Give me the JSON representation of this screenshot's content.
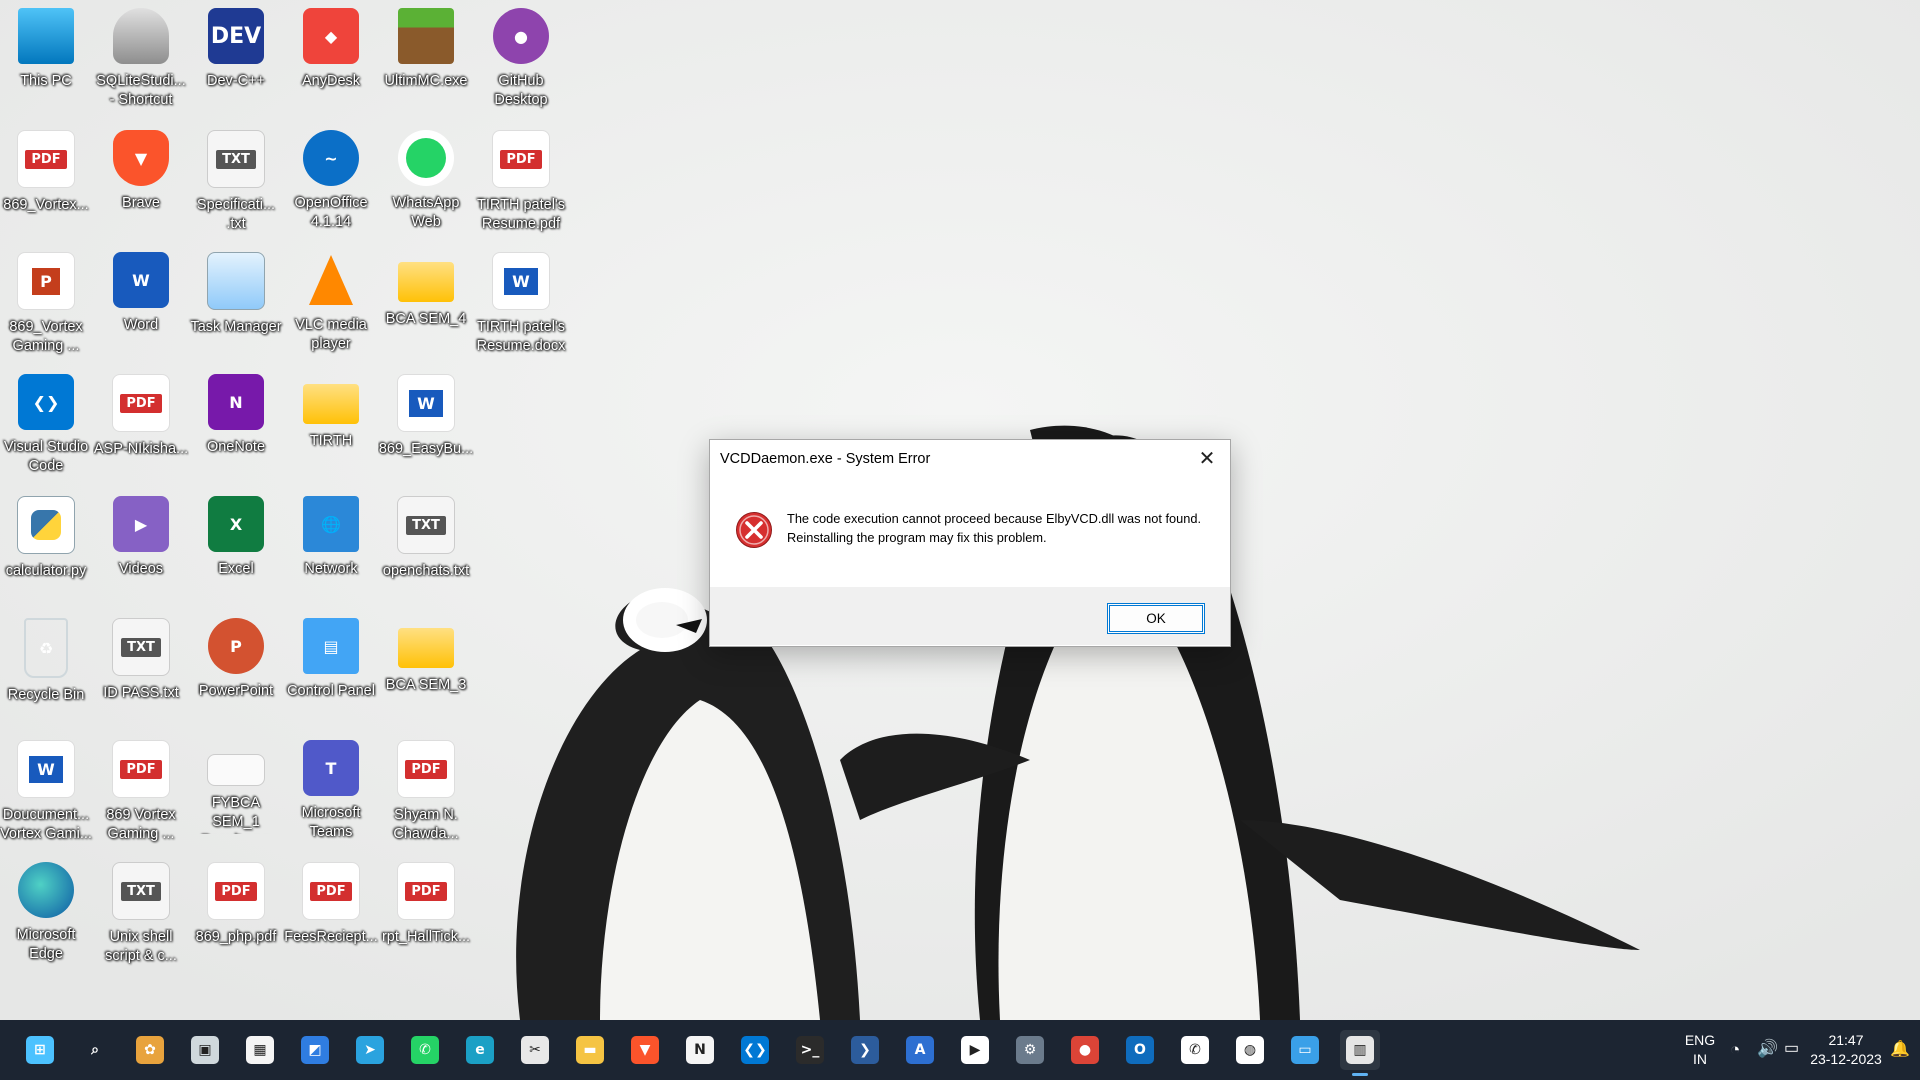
{
  "desktop": {
    "icons": [
      {
        "label": "This PC",
        "icon": "monitor-icon",
        "kind": "g-pc",
        "glyph": ""
      },
      {
        "label": "SQLiteStudi... - Shortcut",
        "icon": "database-icon",
        "kind": "g-db",
        "glyph": ""
      },
      {
        "label": "Dev-C++",
        "icon": "dev-cpp-icon",
        "kind": "g-dev",
        "glyph": "DEV"
      },
      {
        "label": "AnyDesk",
        "icon": "anydesk-icon",
        "kind": "g-any",
        "glyph": "◆"
      },
      {
        "label": "UltimMC.exe",
        "icon": "minecraft-icon",
        "kind": "g-mc",
        "glyph": ""
      },
      {
        "label": "GitHub Desktop",
        "icon": "github-icon",
        "kind": "g-gh",
        "glyph": "●"
      },
      {
        "label": "869_Vortex...",
        "icon": "pdf-file-icon",
        "kind": "g-pdf",
        "glyph": "PDF"
      },
      {
        "label": "Brave",
        "icon": "brave-icon",
        "kind": "g-brave",
        "glyph": "▼"
      },
      {
        "label": "Specificati... .txt",
        "icon": "txt-file-icon",
        "kind": "g-txt",
        "glyph": "TXT"
      },
      {
        "label": "OpenOffice 4.1.14",
        "icon": "openoffice-icon",
        "kind": "g-oo",
        "glyph": "~"
      },
      {
        "label": "WhatsApp Web",
        "icon": "whatsapp-icon",
        "kind": "g-wa",
        "glyph": ""
      },
      {
        "label": "TIRTH patel's Resume.pdf",
        "icon": "pdf-file-icon",
        "kind": "g-pdf",
        "glyph": "PDF"
      },
      {
        "label": "869_Vortex Gaming ...",
        "icon": "powerpoint-file-icon",
        "kind": "g-ppt",
        "glyph": "P"
      },
      {
        "label": "Word",
        "icon": "word-icon",
        "kind": "g-word",
        "glyph": "W"
      },
      {
        "label": "Task Manager",
        "icon": "task-manager-icon",
        "kind": "g-tm",
        "glyph": ""
      },
      {
        "label": "VLC media player",
        "icon": "vlc-icon",
        "kind": "g-vlc",
        "glyph": ""
      },
      {
        "label": "BCA SEM_4",
        "icon": "folder-icon",
        "kind": "g-folder",
        "glyph": ""
      },
      {
        "label": "TIRTH patel's Resume.docx",
        "icon": "word-file-icon",
        "kind": "g-word-doc",
        "glyph": "W"
      },
      {
        "label": "Visual Studio Code",
        "icon": "vscode-icon",
        "kind": "g-vs",
        "glyph": "❮❯"
      },
      {
        "label": "ASP-NIkisha...",
        "icon": "pdf-file-icon",
        "kind": "g-pdf",
        "glyph": "PDF"
      },
      {
        "label": "OneNote",
        "icon": "onenote-icon",
        "kind": "g-one",
        "glyph": "N"
      },
      {
        "label": "TIRTH",
        "icon": "user-folder-icon",
        "kind": "g-folder",
        "glyph": ""
      },
      {
        "label": "869_EasyBu...",
        "icon": "word-file-icon",
        "kind": "g-word-doc",
        "glyph": "W"
      },
      {
        "label": "calculator.py",
        "icon": "python-file-icon",
        "kind": "g-py",
        "glyph": ""
      },
      {
        "label": "Videos",
        "icon": "videos-icon",
        "kind": "g-vid",
        "glyph": "▶"
      },
      {
        "label": "Excel",
        "icon": "excel-icon",
        "kind": "g-xl",
        "glyph": "X"
      },
      {
        "label": "Network",
        "icon": "network-icon",
        "kind": "g-net",
        "glyph": "🌐"
      },
      {
        "label": "openchats.txt",
        "icon": "txt-file-icon",
        "kind": "g-txt",
        "glyph": "TXT"
      },
      {
        "label": "Recycle Bin",
        "icon": "recycle-bin-icon",
        "kind": "g-bin",
        "glyph": "♻"
      },
      {
        "label": "ID PASS.txt",
        "icon": "txt-file-icon",
        "kind": "g-txt",
        "glyph": "TXT"
      },
      {
        "label": "PowerPoint",
        "icon": "powerpoint-icon",
        "kind": "g-pp",
        "glyph": "P"
      },
      {
        "label": "Control Panel",
        "icon": "control-panel-icon",
        "kind": "g-cp",
        "glyph": "▤"
      },
      {
        "label": "BCA SEM_3",
        "icon": "folder-icon",
        "kind": "g-folder",
        "glyph": ""
      },
      {
        "label": "Doucument... Vortex Gami...",
        "icon": "word-file-icon",
        "kind": "g-word-doc",
        "glyph": "W"
      },
      {
        "label": "869 Vortex Gaming ...",
        "icon": "pdf-file-icon",
        "kind": "g-pdf",
        "glyph": "PDF"
      },
      {
        "label": "FYBCA SEM_1 Result.png",
        "icon": "image-file-icon",
        "kind": "g-img",
        "glyph": ""
      },
      {
        "label": "Microsoft Teams",
        "icon": "teams-icon",
        "kind": "g-teams",
        "glyph": "T"
      },
      {
        "label": "Shyam N. Chawda...",
        "icon": "pdf-file-icon",
        "kind": "g-pdf",
        "glyph": "PDF"
      },
      {
        "label": "Microsoft Edge",
        "icon": "edge-icon",
        "kind": "g-edge",
        "glyph": ""
      },
      {
        "label": "Unix shell script & c...",
        "icon": "txt-file-icon",
        "kind": "g-txt",
        "glyph": "TXT"
      },
      {
        "label": "869_php.pdf",
        "icon": "pdf-file-icon",
        "kind": "g-pdf",
        "glyph": "PDF"
      },
      {
        "label": "FeesReciept...",
        "icon": "pdf-file-icon",
        "kind": "g-pdf",
        "glyph": "PDF"
      },
      {
        "label": "rpt_HallTick...",
        "icon": "pdf-file-icon",
        "kind": "g-pdf",
        "glyph": "PDF"
      }
    ]
  },
  "dialog": {
    "title": "VCDDaemon.exe - System Error",
    "message": "The code execution cannot proceed because ElbyVCD.dll was not found. Reinstalling the program may fix this problem.",
    "ok_label": "OK",
    "icon": "error-icon"
  },
  "taskbar": {
    "apps": [
      {
        "name": "start-button",
        "icon": "windows-logo-icon",
        "color": "#4cc2ff",
        "glyph": "⊞"
      },
      {
        "name": "search-button",
        "icon": "search-icon",
        "color": "transparent",
        "glyph": "⌕"
      },
      {
        "name": "widgets-button",
        "icon": "widgets-icon",
        "color": "#e8a33d",
        "glyph": "✿"
      },
      {
        "name": "task-view-button",
        "icon": "task-view-icon",
        "color": "#cfd8dc",
        "glyph": "▣"
      },
      {
        "name": "taskbar-store",
        "icon": "store-icon",
        "color": "#f5f5f5",
        "glyph": "▦"
      },
      {
        "name": "taskbar-photos",
        "icon": "photos-icon",
        "color": "#2f7de1",
        "glyph": "◩"
      },
      {
        "name": "taskbar-telegram",
        "icon": "telegram-icon",
        "color": "#2aa3df",
        "glyph": "➤"
      },
      {
        "name": "taskbar-whatsapp",
        "icon": "whatsapp-icon",
        "color": "#25d366",
        "glyph": "✆"
      },
      {
        "name": "taskbar-edge",
        "icon": "edge-icon",
        "color": "#1ba0c5",
        "glyph": "e"
      },
      {
        "name": "taskbar-snipping",
        "icon": "snipping-tool-icon",
        "color": "#e8e8e8",
        "glyph": "✂"
      },
      {
        "name": "taskbar-explorer",
        "icon": "folder-icon",
        "color": "#f5c443",
        "glyph": "▬"
      },
      {
        "name": "taskbar-brave",
        "icon": "brave-icon",
        "color": "#fb542b",
        "glyph": "▼"
      },
      {
        "name": "taskbar-notion",
        "icon": "notion-icon",
        "color": "#f5f5f5",
        "glyph": "N"
      },
      {
        "name": "taskbar-vscode",
        "icon": "vscode-icon",
        "color": "#0078d4",
        "glyph": "❮❯"
      },
      {
        "name": "taskbar-terminal",
        "icon": "terminal-icon",
        "color": "#2b2b2b",
        "glyph": ">_"
      },
      {
        "name": "taskbar-powershell",
        "icon": "powershell-icon",
        "color": "#2c5c9c",
        "glyph": "❯"
      },
      {
        "name": "taskbar-app-a",
        "icon": "app-installer-icon",
        "color": "#2d6fd1",
        "glyph": "A"
      },
      {
        "name": "taskbar-play",
        "icon": "play-store-icon",
        "color": "#ffffff",
        "glyph": "▶"
      },
      {
        "name": "taskbar-settings",
        "icon": "settings-icon",
        "color": "#6b7b8c",
        "glyph": "⚙"
      },
      {
        "name": "taskbar-chrome",
        "icon": "chrome-icon",
        "color": "#db4437",
        "glyph": "●"
      },
      {
        "name": "taskbar-outlook",
        "icon": "outlook-icon",
        "color": "#0f6cbd",
        "glyph": "O"
      },
      {
        "name": "taskbar-whatsapp-2",
        "icon": "whatsapp-icon",
        "color": "#ffffff",
        "glyph": "✆"
      },
      {
        "name": "taskbar-globe",
        "icon": "globe-icon",
        "color": "#ffffff",
        "glyph": "◍"
      },
      {
        "name": "taskbar-remote",
        "icon": "remote-desktop-icon",
        "color": "#3aa0e8",
        "glyph": "▭"
      },
      {
        "name": "taskbar-vcd-app",
        "icon": "app-window-icon",
        "color": "#e6e6e6",
        "glyph": "▥"
      }
    ],
    "tray": {
      "language": "ENG",
      "region": "IN",
      "time": "21:47",
      "date": "23-12-2023"
    }
  }
}
